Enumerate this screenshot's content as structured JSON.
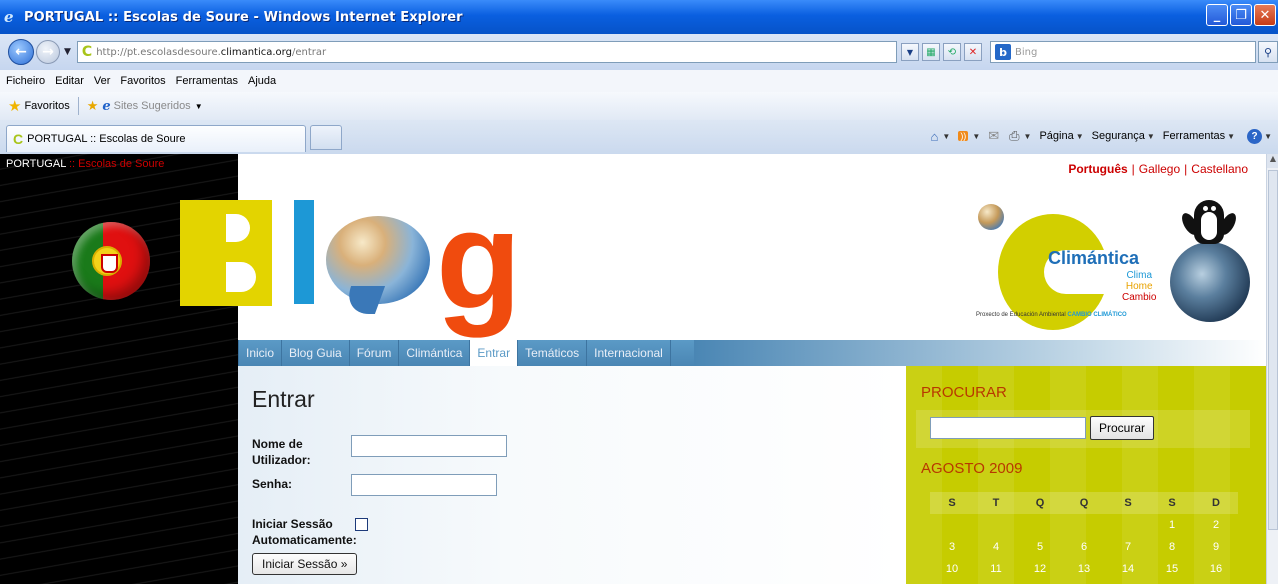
{
  "browser": {
    "title": "PORTUGAL :: Escolas de Soure - Windows Internet Explorer",
    "url_prefix": "http://pt.escolasdesoure.",
    "url_domain": "climantica.org",
    "url_path": "/entrar",
    "search_placeholder": "Bing",
    "menu": [
      "Ficheiro",
      "Editar",
      "Ver",
      "Favoritos",
      "Ferramentas",
      "Ajuda"
    ],
    "favorites_label": "Favoritos",
    "suggested_sites": "Sites Sugeridos",
    "tab_title": "PORTUGAL :: Escolas de Soure",
    "cmd": {
      "page": "Página",
      "security": "Segurança",
      "tools": "Ferramentas"
    }
  },
  "site": {
    "name_pt": "PORTUGAL",
    "name_sep": " :: ",
    "name_school": "Escolas de Soure",
    "languages": {
      "active": "Português",
      "gallego": "Gallego",
      "castellano": "Castellano"
    },
    "logo": {
      "title": "Climántica",
      "sub1": "Clima",
      "sub2": "Home",
      "sub3": "Cambio",
      "tagline": "Proxecto de Educación Ambiental ",
      "tagline_bold": "CAMBIO CLIMÁTICO"
    },
    "nav": [
      "Inicio",
      "Blog Guia",
      "Fórum",
      "Climántica",
      "Entrar",
      "Temáticos",
      "Internacional"
    ],
    "nav_active": "Entrar"
  },
  "login": {
    "heading": "Entrar",
    "username_label_1": "Nome de",
    "username_label_2": "Utilizador:",
    "password_label": "Senha:",
    "auto_label_1": "Iniciar Sessão",
    "auto_label_2": "Automaticamente:",
    "submit": "Iniciar Sessão »"
  },
  "sidebar": {
    "search_heading": "PROCURAR",
    "search_button": "Procurar",
    "calendar_heading": "AGOSTO 2009",
    "calendar_days": [
      "S",
      "T",
      "Q",
      "Q",
      "S",
      "S",
      "D"
    ],
    "calendar_rows": [
      [
        "",
        "",
        "",
        "",
        "",
        "1",
        "2"
      ],
      [
        "3",
        "4",
        "5",
        "6",
        "7",
        "8",
        "9"
      ],
      [
        "10",
        "11",
        "12",
        "13",
        "14",
        "15",
        "16"
      ]
    ]
  }
}
